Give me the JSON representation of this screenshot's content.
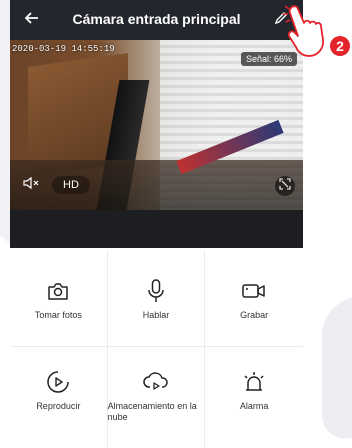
{
  "header": {
    "title": "Cámara entrada principal",
    "back_icon": "arrow-left-icon",
    "edit_icon": "pencil-icon"
  },
  "video": {
    "timestamp": "2020-03-19 14:55:19",
    "signal_label": "Señal: 66%",
    "quality_label": "HD",
    "mute_icon": "speaker-muted-icon",
    "fullscreen_icon": "fullscreen-icon"
  },
  "actions": [
    {
      "label": "Tomar fotos",
      "icon": "camera-icon"
    },
    {
      "label": "Hablar",
      "icon": "microphone-icon"
    },
    {
      "label": "Grabar",
      "icon": "video-camera-icon"
    },
    {
      "label": "Reproducir",
      "icon": "play-icon"
    },
    {
      "label": "Almacenamiento en la nube",
      "icon": "cloud-play-icon"
    },
    {
      "label": "Alarma",
      "icon": "alarm-light-icon"
    }
  ],
  "overlay": {
    "step_number": "2",
    "hand_icon": "pointing-hand-icon",
    "accent_color": "#e3242b"
  },
  "colors": {
    "header_bg": "#23262c",
    "accent": "#e3242b"
  }
}
